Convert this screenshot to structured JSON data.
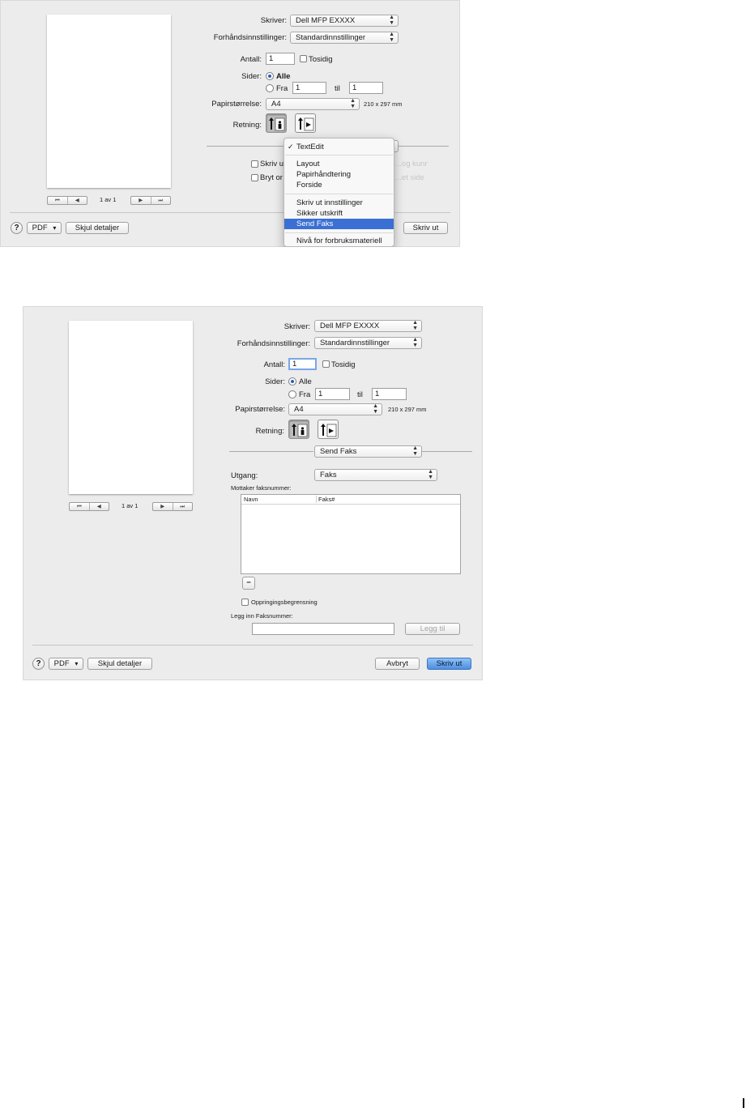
{
  "dialog1": {
    "printer_label": "Skriver:",
    "printer_value": "Dell MFP EXXXX",
    "presets_label": "Forhåndsinnstillinger:",
    "presets_value": "Standardinnstillinger",
    "copies_label": "Antall:",
    "copies_value": "1",
    "twosided_label": "Tosidig",
    "pages_label": "Sider:",
    "pages_all": "Alle",
    "pages_from": "Fra",
    "pages_from_value": "1",
    "pages_to": "til",
    "pages_to_value": "1",
    "paper_label": "Papirstørrelse:",
    "paper_value": "A4",
    "paper_dims": "210 x 297 mm",
    "orientation_label": "Retning:",
    "hidden_checkbox1_label": "Skriv ut",
    "hidden_checkbox1_ghost": "...og kunnsteker",
    "hidden_checkbox2_label": "Bryt or",
    "hidden_checkbox2_ghost": "...et side",
    "page_counter": "1 av 1",
    "help_label": "?",
    "pdf_label": "PDF",
    "hide_details_label": "Skjul detaljer",
    "print_label": "Skriv ut",
    "menu": {
      "checked_item": "TextEdit",
      "group1": [
        "Layout",
        "Papirhåndtering",
        "Forside"
      ],
      "group2": [
        "Skriv ut innstillinger",
        "Sikker utskrift",
        "Send Faks"
      ],
      "highlighted": "Send Faks",
      "group3": [
        "Nivå for forbruksmateriell"
      ]
    }
  },
  "dialog2": {
    "printer_label": "Skriver:",
    "printer_value": "Dell MFP EXXXX",
    "presets_label": "Forhåndsinnstillinger:",
    "presets_value": "Standardinnstillinger",
    "copies_label": "Antall:",
    "copies_value": "1",
    "twosided_label": "Tosidig",
    "pages_label": "Sider:",
    "pages_all": "Alle",
    "pages_from": "Fra",
    "pages_from_value": "1",
    "pages_to": "til",
    "pages_to_value": "1",
    "paper_label": "Papirstørrelse:",
    "paper_value": "A4",
    "paper_dims": "210 x 297 mm",
    "orientation_label": "Retning:",
    "section_value": "Send Faks",
    "output_label": "Utgang:",
    "output_value": "Faks",
    "recipients_label": "Mottaker faksnummer:",
    "col_name": "Navn",
    "col_fax": "Faks#",
    "remove_label": "−",
    "dial_limit_label": "Oppringingsbegrensning",
    "enter_fax_label": "Legg inn Faksnummer:",
    "enter_fax_value": "",
    "add_label": "Legg til",
    "page_counter": "1 av 1",
    "help_label": "?",
    "pdf_label": "PDF",
    "hide_details_label": "Skjul detaljer",
    "cancel_label": "Avbryt",
    "print_label": "Skriv ut"
  },
  "icons": {
    "popup_arrows": "updown-chevron-icon",
    "nav_first": "⏮",
    "nav_prev": "◀",
    "nav_next": "▶",
    "nav_last": "⏭",
    "pdf_arrow": "▾",
    "checkmark": "✓"
  },
  "colors": {
    "dialog_bg": "#ececec",
    "highlight": "#3b6fd3",
    "primary_button": "#4d8fe0"
  }
}
